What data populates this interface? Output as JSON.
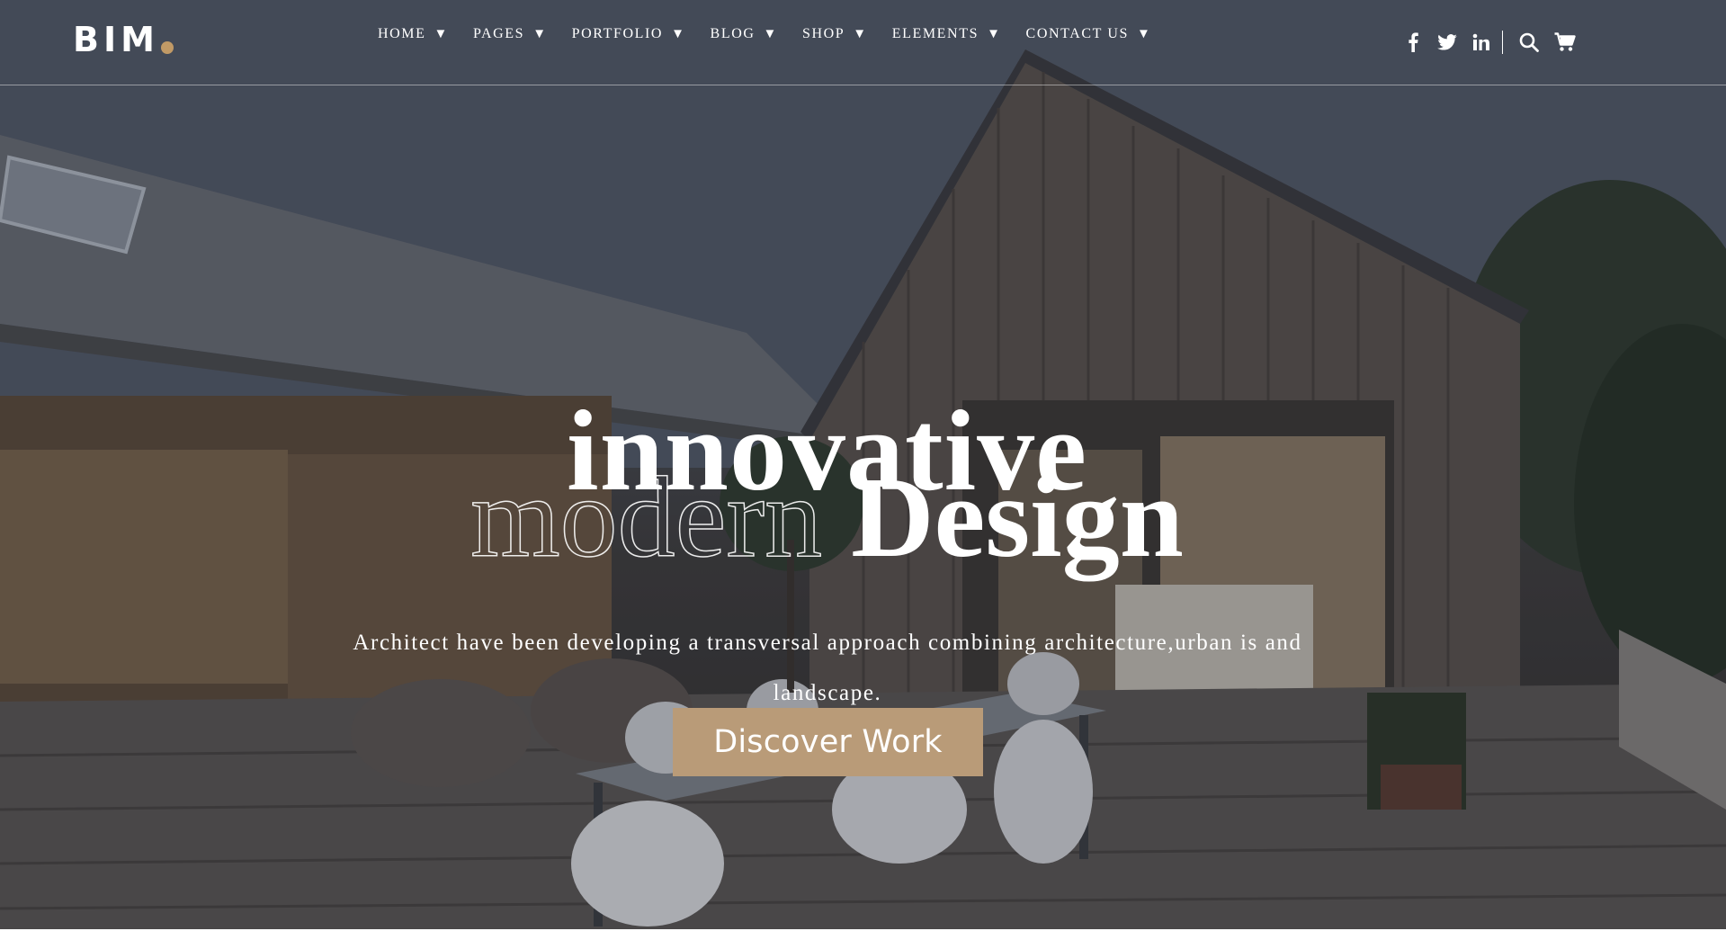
{
  "brand": {
    "logo_text": "BIM",
    "accent": "#c19a66"
  },
  "nav": {
    "items": [
      {
        "label": "HOME",
        "caret": "▼"
      },
      {
        "label": "PAGES",
        "caret": "▼"
      },
      {
        "label": "PORTFOLIO",
        "caret": "▼"
      },
      {
        "label": "BLOG",
        "caret": "▼"
      },
      {
        "label": "SHOP",
        "caret": "▼"
      },
      {
        "label": "ELEMENTS",
        "caret": "▼"
      },
      {
        "label": "CONTACT US",
        "caret": "▼"
      }
    ]
  },
  "social": {
    "icons": [
      "facebook-icon",
      "twitter-icon",
      "linkedin-icon"
    ]
  },
  "tools": {
    "icons": [
      "search-icon",
      "cart-icon"
    ]
  },
  "hero": {
    "headline_top": "innovative",
    "headline_outline": "modern",
    "headline_solid": "Design",
    "subtext": "Architect have been developing a transversal approach combining architecture,urban is and landscape.",
    "cta_label": "Discover Work",
    "cta_color": "#b99b78"
  }
}
